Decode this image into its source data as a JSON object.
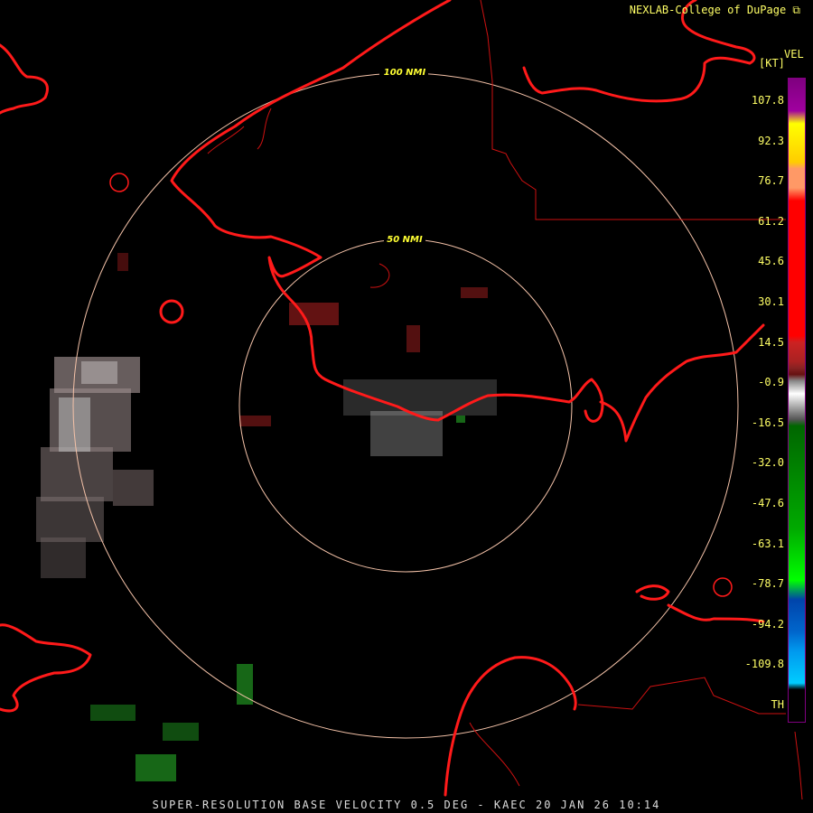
{
  "header": {
    "credit": "NEXLAB-College of DuPage",
    "credit_icon": "external-link-icon"
  },
  "rings": {
    "inner_label": "50 NMI",
    "outer_label": "100 NMI",
    "color": "#f4c2a8"
  },
  "legend": {
    "title": "VEL",
    "unit": "[KT]",
    "ticks": [
      "107.8",
      "92.3",
      "76.7",
      "61.2",
      "45.6",
      "30.1",
      "14.5",
      "-0.9",
      "-16.5",
      "-32.0",
      "-47.6",
      "-63.1",
      "-78.7",
      "-94.2",
      "-109.8",
      "TH"
    ],
    "label_color": "#ffff66"
  },
  "colors": {
    "coastline": "#ff1a1a",
    "background": "#000000"
  },
  "footer": {
    "caption": "SUPER-RESOLUTION BASE VELOCITY 0.5 DEG - KAEC 20 JAN 26 10:14"
  }
}
